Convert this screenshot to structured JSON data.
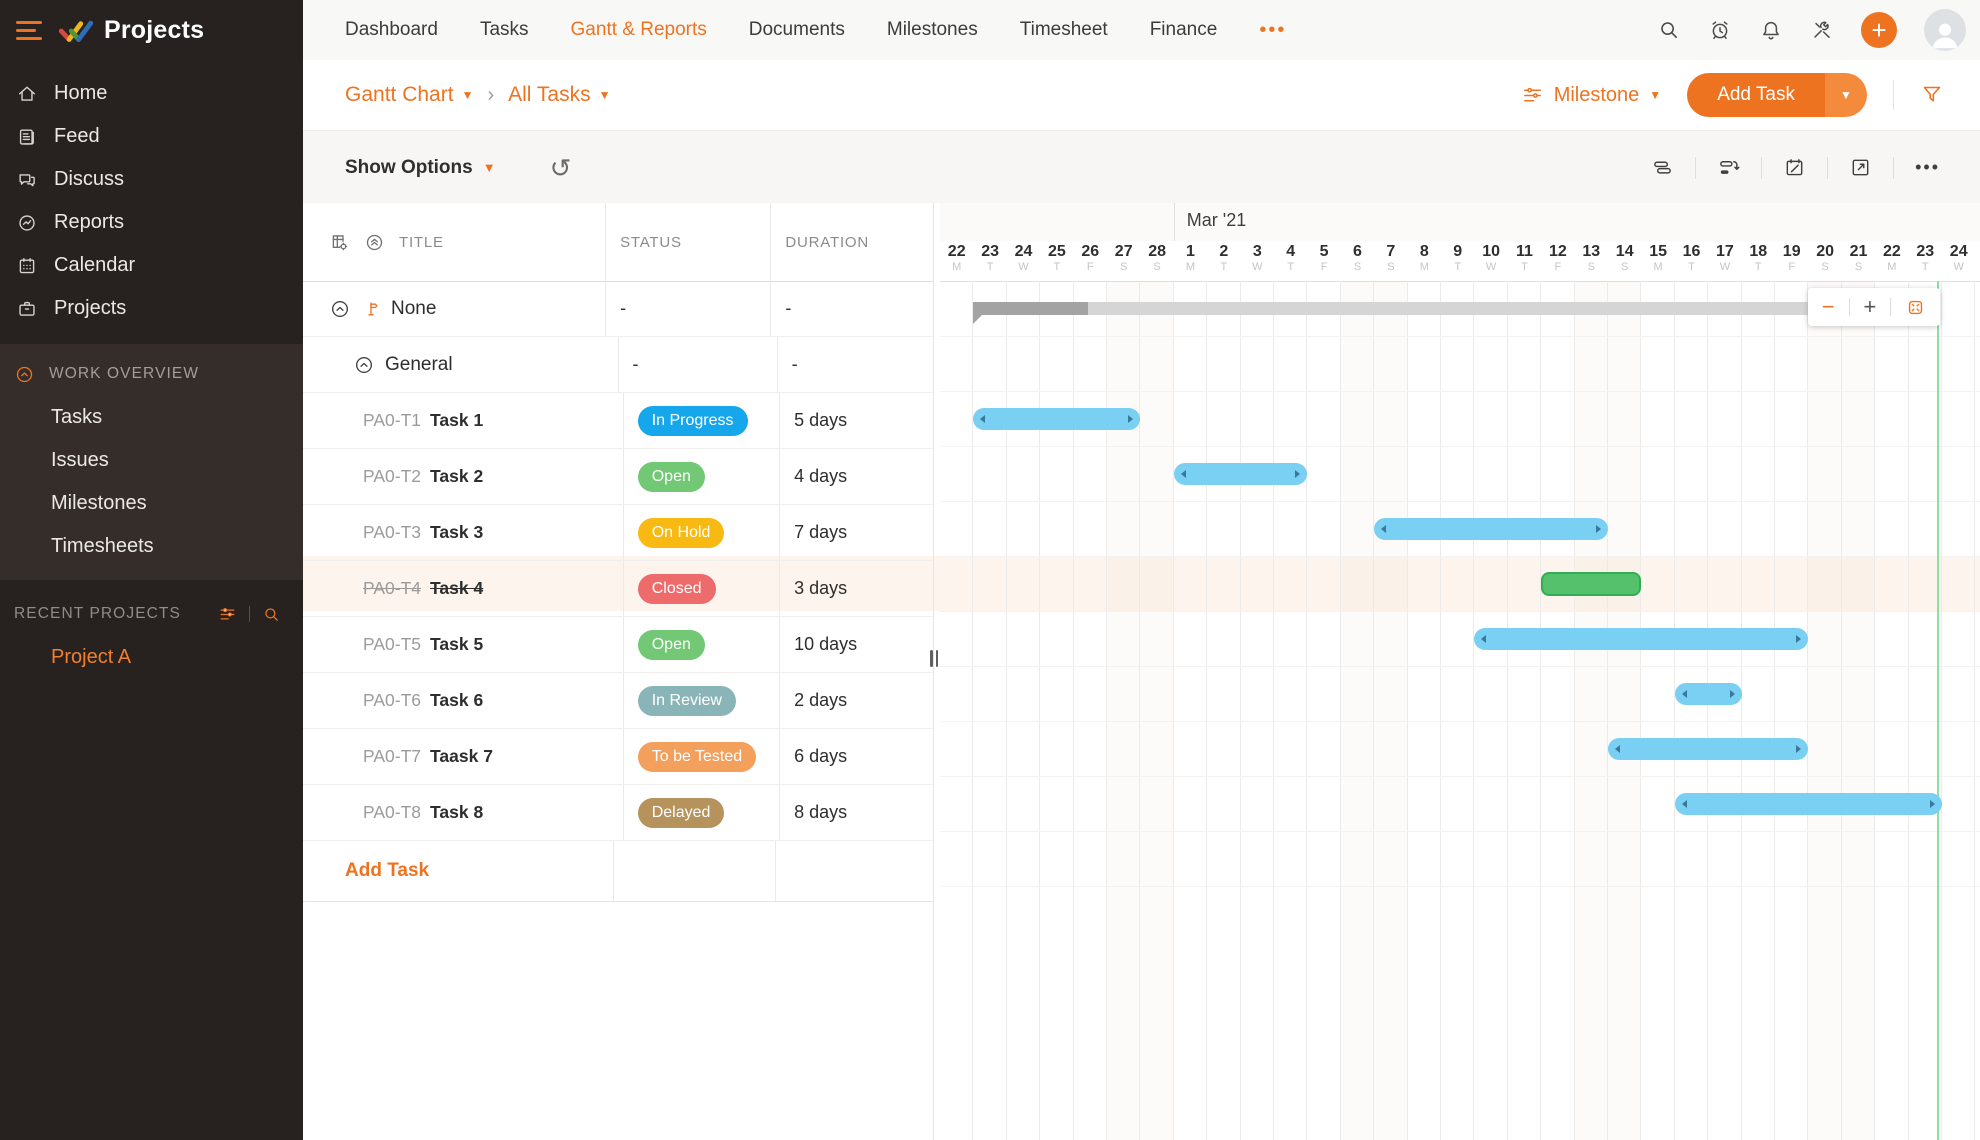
{
  "sidebar": {
    "app_title": "Projects",
    "nav": [
      {
        "label": "Home",
        "icon": "home"
      },
      {
        "label": "Feed",
        "icon": "feed"
      },
      {
        "label": "Discuss",
        "icon": "discuss"
      },
      {
        "label": "Reports",
        "icon": "reports"
      },
      {
        "label": "Calendar",
        "icon": "calendar"
      },
      {
        "label": "Projects",
        "icon": "briefcase"
      }
    ],
    "work_overview": {
      "label": "WORK OVERVIEW",
      "items": [
        "Tasks",
        "Issues",
        "Milestones",
        "Timesheets"
      ]
    },
    "recent_projects": {
      "label": "RECENT PROJECTS",
      "items": [
        "Project A"
      ]
    }
  },
  "topnav": {
    "tabs": [
      "Dashboard",
      "Tasks",
      "Gantt & Reports",
      "Documents",
      "Milestones",
      "Timesheet",
      "Finance"
    ],
    "active_tab": "Gantt & Reports",
    "overflow": "•••",
    "plus_label": "+"
  },
  "header": {
    "breadcrumb": [
      "Gantt Chart",
      "All Tasks"
    ],
    "group_by": "Milestone",
    "add_task": "Add Task"
  },
  "toolbar": {
    "show_options": "Show Options",
    "more": "•••"
  },
  "table": {
    "columns": [
      "TITLE",
      "STATUS",
      "DURATION"
    ],
    "group_rows": [
      {
        "title": "None",
        "level": 1,
        "status": "-",
        "duration": "-",
        "milestone_icon": true
      },
      {
        "title": "General",
        "level": 2,
        "status": "-",
        "duration": "-"
      }
    ],
    "rows": [
      {
        "id": "PA0-T1",
        "title": "Task 1",
        "status": "In Progress",
        "duration": "5 days",
        "bar": {
          "start": 1,
          "days": 5
        }
      },
      {
        "id": "PA0-T2",
        "title": "Task 2",
        "status": "Open",
        "duration": "4 days",
        "bar": {
          "start": 7,
          "days": 4
        }
      },
      {
        "id": "PA0-T3",
        "title": "Task 3",
        "status": "On Hold",
        "duration": "7 days",
        "bar": {
          "start": 13,
          "days": 7
        }
      },
      {
        "id": "PA0-T4",
        "title": "Task 4",
        "status": "Closed",
        "duration": "3 days",
        "strikethrough": true,
        "highlight": true,
        "bar": {
          "start": 18,
          "days": 3
        }
      },
      {
        "id": "PA0-T5",
        "title": "Task 5",
        "status": "Open",
        "duration": "10 days",
        "bar": {
          "start": 16,
          "days": 10
        }
      },
      {
        "id": "PA0-T6",
        "title": "Task 6",
        "status": "In Review",
        "duration": "2 days",
        "bar": {
          "start": 22,
          "days": 2
        }
      },
      {
        "id": "PA0-T7",
        "title": "Taask 7",
        "status": "To be Tested",
        "duration": "6 days",
        "bar": {
          "start": 20,
          "days": 6
        }
      },
      {
        "id": "PA0-T8",
        "title": "Task 8",
        "status": "Delayed",
        "duration": "8 days",
        "bar": {
          "start": 22,
          "days": 8
        }
      }
    ],
    "add_task": "Add Task"
  },
  "timeline": {
    "month_label": "Mar '21",
    "month_start_index": 7,
    "days": [
      {
        "n": "22",
        "d": "M"
      },
      {
        "n": "23",
        "d": "T"
      },
      {
        "n": "24",
        "d": "W"
      },
      {
        "n": "25",
        "d": "T"
      },
      {
        "n": "26",
        "d": "F"
      },
      {
        "n": "27",
        "d": "S"
      },
      {
        "n": "28",
        "d": "S"
      },
      {
        "n": "1",
        "d": "M"
      },
      {
        "n": "2",
        "d": "T"
      },
      {
        "n": "3",
        "d": "W"
      },
      {
        "n": "4",
        "d": "T"
      },
      {
        "n": "5",
        "d": "F"
      },
      {
        "n": "6",
        "d": "S"
      },
      {
        "n": "7",
        "d": "S"
      },
      {
        "n": "8",
        "d": "M"
      },
      {
        "n": "9",
        "d": "T"
      },
      {
        "n": "10",
        "d": "W"
      },
      {
        "n": "11",
        "d": "T"
      },
      {
        "n": "12",
        "d": "F"
      },
      {
        "n": "13",
        "d": "S"
      },
      {
        "n": "14",
        "d": "S"
      },
      {
        "n": "15",
        "d": "M"
      },
      {
        "n": "16",
        "d": "T"
      },
      {
        "n": "17",
        "d": "W"
      },
      {
        "n": "18",
        "d": "T"
      },
      {
        "n": "19",
        "d": "F"
      },
      {
        "n": "20",
        "d": "S"
      },
      {
        "n": "21",
        "d": "S"
      },
      {
        "n": "22",
        "d": "M"
      },
      {
        "n": "23",
        "d": "T"
      },
      {
        "n": "24",
        "d": "W"
      }
    ]
  },
  "gantt": {
    "summary_bar": {
      "row": 1,
      "start": 1,
      "span": 28.65,
      "progress": 0.12
    },
    "today_day": 29.85
  },
  "zoom_controls": {
    "minus": "−",
    "plus": "+"
  },
  "colors": {
    "accent": "#ee7321",
    "bar_blue": "#79d0f2",
    "bar_green": "#55c16d",
    "summary": "#d5d5d5",
    "summary_dark": "#a3a3a3",
    "highlight_row": "#fdf5ed",
    "today_line": "#8fdf9f",
    "status": {
      "In Progress": "#16a6ec",
      "Open": "#72c874",
      "On Hold": "#f8ba12",
      "Closed": "#ee6b6b",
      "In Review": "#8ab5b8",
      "To be Tested": "#f2a05b",
      "Delayed": "#b6925d"
    }
  }
}
